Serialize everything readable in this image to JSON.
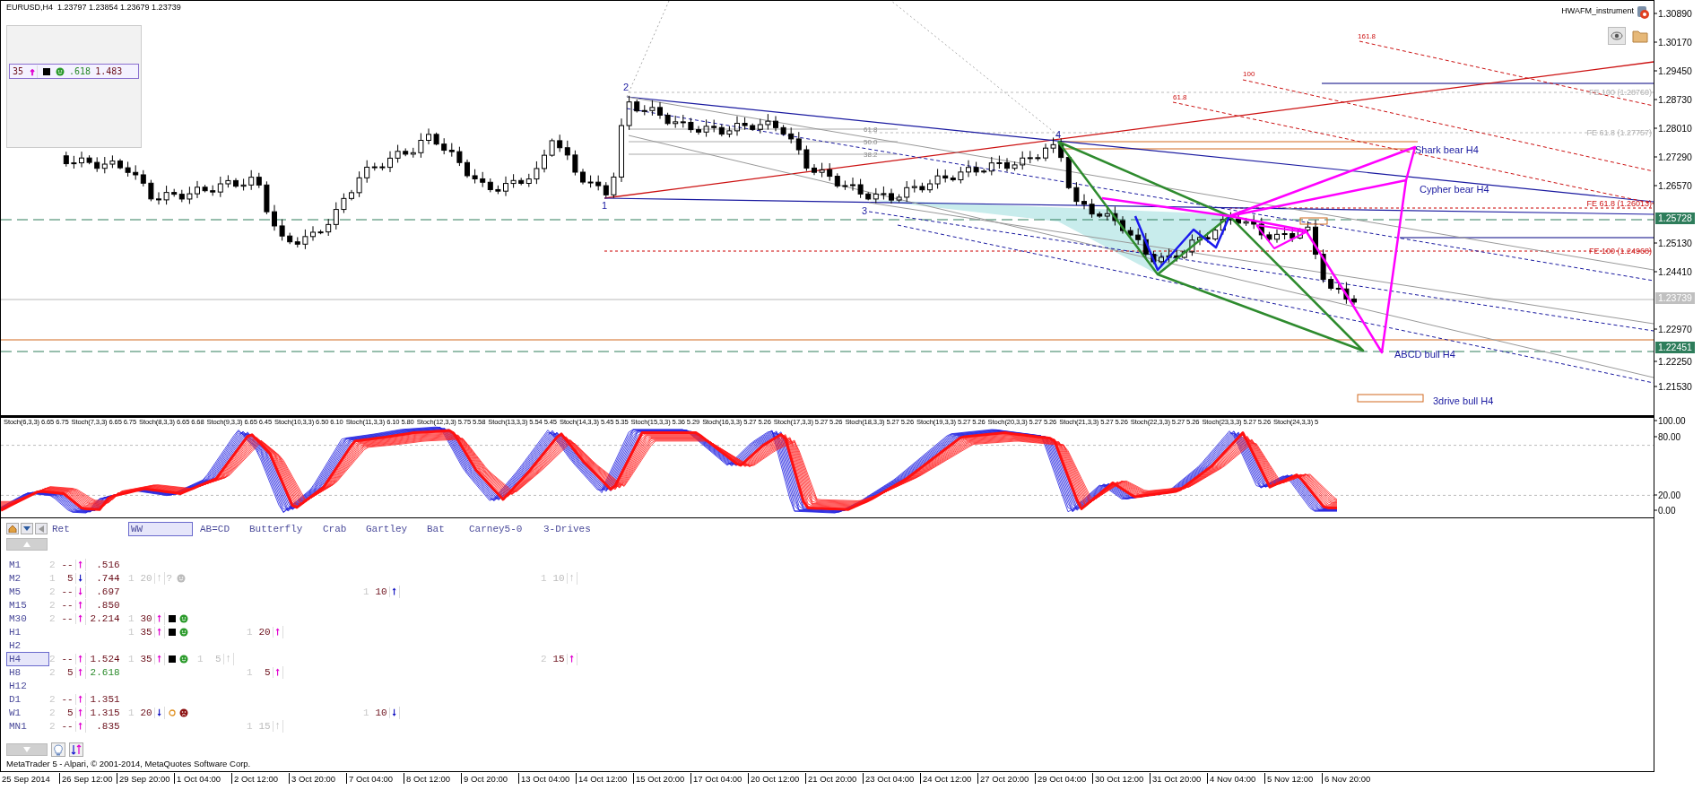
{
  "chart": {
    "symbol": "EURUSD,H4",
    "quote": "1.23797 1.23854 1.23679 1.23739",
    "indicator_name": "HWAFM_instrument",
    "info_panel": {
      "count": "35",
      "arrow": {
        "text": "↑",
        "color": "#e000d0"
      },
      "marks": [
        {
          "kind": "square"
        },
        {
          "kind": "smiley"
        }
      ],
      "ratio": ".618",
      "value": "1.483"
    },
    "labels": [
      {
        "text": "161.8",
        "kind": "fib_red"
      },
      {
        "text": "100",
        "kind": "fib_red"
      },
      {
        "text": "2",
        "kind": "point"
      },
      {
        "text": "61.8",
        "kind": "fib_red"
      },
      {
        "text": "FE 100 (1.28760)",
        "kind": "fe"
      },
      {
        "text": "61.8",
        "kind": "fib"
      },
      {
        "text": "4",
        "kind": "point"
      },
      {
        "text": "FE 61.8 (1.27757)",
        "kind": "fe"
      },
      {
        "text": "50.0",
        "kind": "fib"
      },
      {
        "text": "Shark bear H4",
        "kind": "pattern"
      },
      {
        "text": "38.2",
        "kind": "fib"
      },
      {
        "text": "Cypher bear H4",
        "kind": "pattern"
      },
      {
        "text": "1",
        "kind": "point"
      },
      {
        "text": "3",
        "kind": "point"
      },
      {
        "text": "FE 61.8 (1.26013)",
        "kind": "fe_red"
      },
      {
        "text": "FE 100 (1.24968)",
        "kind": "fe_red"
      },
      {
        "text": "ABCD bull H4",
        "kind": "pattern"
      },
      {
        "text": "3drive bull H4",
        "kind": "pattern"
      }
    ],
    "price_axis": [
      "1.30890",
      "1.30170",
      "1.29450",
      "1.28730",
      "1.28010",
      "1.27290",
      "1.26570",
      "1.25130",
      "1.24410",
      "1.22970",
      "1.22250",
      "1.21530"
    ],
    "price_badges": [
      {
        "text": "1.25728",
        "kind": "level"
      },
      {
        "text": "1.23739",
        "kind": "price"
      },
      {
        "text": "1.22451",
        "kind": "level"
      }
    ]
  },
  "stochastic": {
    "legend": [
      "Stoch(6,3,3) 6.65 6.75",
      "Stoch(7,3,3) 6.65 6.75",
      "Stoch(8,3,3) 6.65 6.68",
      "Stoch(9,3,3) 6.65 6.45",
      "Stoch(10,3,3) 6.50 6.10",
      "Stoch(11,3,3) 6.10 5.80",
      "Stoch(12,3,3) 5.75 5.58",
      "Stoch(13,3,3) 5.54 5.45",
      "Stoch(14,3,3) 5.45 5.35",
      "Stoch(15,3,3) 5.36 5.29",
      "Stoch(16,3,3) 5.27 5.26",
      "Stoch(17,3,3) 5.27 5.26",
      "Stoch(18,3,3) 5.27 5.26",
      "Stoch(19,3,3) 5.27 5.26",
      "Stoch(20,3,3) 5.27 5.26",
      "Stoch(21,3,3) 5.27 5.26",
      "Stoch(22,3,3) 5.27 5.26",
      "Stoch(23,3,3) 5.27 5.26",
      "Stoch(24,3,3) 5"
    ],
    "axis": [
      "100.00",
      "80.00",
      "20.00",
      "0.00"
    ]
  },
  "panel": {
    "tabs": [
      {
        "label": "Ret",
        "selected": false
      },
      {
        "label": "WW",
        "selected": true
      },
      {
        "label": "AB=CD",
        "selected": false
      },
      {
        "label": "Butterfly",
        "selected": false
      },
      {
        "label": "Crab",
        "selected": false
      },
      {
        "label": "Gartley",
        "selected": false
      },
      {
        "label": "Bat",
        "selected": false
      },
      {
        "label": "Carney5-0",
        "selected": false
      },
      {
        "label": "3-Drives",
        "selected": false
      }
    ],
    "rows": [
      {
        "tf": "M1",
        "selected": false,
        "cells": [
          {
            "n": "2",
            "count": "--",
            "arrow": {
              "text": "↑",
              "color": "#e000d0"
            },
            "value": ".516",
            "highlight": false
          }
        ]
      },
      {
        "tf": "M2",
        "selected": false,
        "cells": [
          {
            "n": "1",
            "count": "5",
            "arrow": {
              "text": "↓",
              "color": "#1010c0"
            },
            "value": ".744",
            "highlight": false
          },
          {
            "n": "1",
            "count": "20",
            "arrow": {
              "text": "↑"
            },
            "marks": [
              {
                "kind": "question",
                "text": "?"
              },
              {
                "kind": "smiley"
              }
            ],
            "faded": true
          },
          "",
          "",
          "",
          "",
          "",
          "",
          {
            "n": "1",
            "count": "10",
            "arrow": {
              "text": "↑"
            },
            "faded": true
          }
        ]
      },
      {
        "tf": "M5",
        "selected": false,
        "cells": [
          {
            "n": "2",
            "count": "--",
            "arrow": {
              "text": "↓",
              "color": "#e000d0"
            },
            "value": ".697",
            "highlight": false
          },
          "",
          "",
          "",
          "",
          {
            "n": "1",
            "count": "10",
            "arrow": {
              "text": "↑",
              "color": "#1010c0"
            },
            "faded": false
          }
        ]
      },
      {
        "tf": "M15",
        "selected": false,
        "cells": [
          {
            "n": "2",
            "count": "--",
            "arrow": {
              "text": "↑",
              "color": "#e000d0"
            },
            "value": ".850",
            "highlight": false
          }
        ]
      },
      {
        "tf": "M30",
        "selected": false,
        "cells": [
          {
            "n": "2",
            "count": "--",
            "arrow": {
              "text": "↑",
              "color": "#e000d0"
            },
            "value": "2.214",
            "highlight": false
          },
          {
            "n": "1",
            "count": "30",
            "arrow": {
              "text": "↑",
              "color": "#e000d0"
            },
            "marks": [
              {
                "kind": "square"
              },
              {
                "kind": "smiley"
              }
            ],
            "faded": false
          }
        ]
      },
      {
        "tf": "H1",
        "selected": false,
        "cells": [
          "",
          {
            "n": "1",
            "count": "35",
            "arrow": {
              "text": "↑",
              "color": "#e000d0"
            },
            "marks": [
              {
                "kind": "square"
              },
              {
                "kind": "smiley"
              }
            ],
            "faded": false
          },
          "",
          {
            "n": "1",
            "count": "20",
            "arrow": {
              "text": "↑",
              "color": "#e000d0"
            },
            "faded": false
          }
        ]
      },
      {
        "tf": "H2",
        "selected": false
      },
      {
        "tf": "H4",
        "selected": true,
        "cells": [
          {
            "n": "2",
            "count": "--",
            "arrow": {
              "text": "↑",
              "color": "#e000d0"
            },
            "value": "1.524",
            "highlight": false
          },
          {
            "n": "1",
            "count": "35",
            "arrow": {
              "text": "↑",
              "color": "#e000d0"
            },
            "marks": [
              {
                "kind": "square"
              },
              {
                "kind": "smiley"
              }
            ],
            "faded": false
          },
          {
            "n": "1",
            "count": "5",
            "arrow": {
              "text": "↑"
            },
            "faded": true
          },
          "",
          "",
          "",
          "",
          "",
          {
            "n": "2",
            "count": "15",
            "arrow": {
              "text": "↑",
              "color": "#e000d0"
            },
            "faded": false
          }
        ]
      },
      {
        "tf": "H8",
        "selected": false,
        "cells": [
          {
            "n": "2",
            "count": "5",
            "arrow": {
              "text": "↑",
              "color": "#e000d0"
            },
            "value": "2.618",
            "highlight": true
          },
          "",
          "",
          {
            "n": "1",
            "count": "5",
            "arrow": {
              "text": "↑",
              "color": "#e000d0"
            },
            "faded": false
          }
        ]
      },
      {
        "tf": "H12",
        "selected": false
      },
      {
        "tf": "D1",
        "selected": false,
        "cells": [
          {
            "n": "2",
            "count": "--",
            "arrow": {
              "text": "↑",
              "color": "#e000d0"
            },
            "value": "1.351",
            "highlight": false
          }
        ]
      },
      {
        "tf": "W1",
        "selected": false,
        "cells": [
          {
            "n": "2",
            "count": "5",
            "arrow": {
              "text": "↑",
              "color": "#e000d0"
            },
            "value": "1.315",
            "highlight": false
          },
          {
            "n": "1",
            "count": "20",
            "arrow": {
              "text": "↓",
              "color": "#1010c0"
            },
            "marks": [
              {
                "kind": "ring"
              },
              {
                "kind": "frown"
              }
            ],
            "faded": false
          },
          "",
          "",
          "",
          {
            "n": "1",
            "count": "10",
            "arrow": {
              "text": "↓",
              "color": "#1010c0"
            },
            "faded": false
          }
        ]
      },
      {
        "tf": "MN1",
        "selected": false,
        "cells": [
          {
            "n": "2",
            "count": "--",
            "arrow": {
              "text": "↑",
              "color": "#e000d0"
            },
            "value": ".835",
            "highlight": false
          },
          "",
          "",
          {
            "n": "1",
            "count": "15",
            "arrow": {
              "text": "↑"
            },
            "faded": true
          }
        ]
      }
    ],
    "status": "MetaTrader 5 - Alpari, © 2001-2014, MetaQuotes Software Corp."
  },
  "time_axis": [
    "25 Sep 2014",
    "26 Sep 12:00",
    "29 Sep 20:00",
    "1 Oct 04:00",
    "2 Oct 12:00",
    "3 Oct 20:00",
    "7 Oct 04:00",
    "8 Oct 12:00",
    "9 Oct 20:00",
    "13 Oct 04:00",
    "14 Oct 12:00",
    "15 Oct 20:00",
    "17 Oct 04:00",
    "20 Oct 12:00",
    "21 Oct 20:00",
    "23 Oct 04:00",
    "24 Oct 12:00",
    "27 Oct 20:00",
    "29 Oct 04:00",
    "30 Oct 12:00",
    "31 Oct 20:00",
    "4 Nov 04:00",
    "5 Nov 12:00",
    "6 Nov 20:00"
  ]
}
